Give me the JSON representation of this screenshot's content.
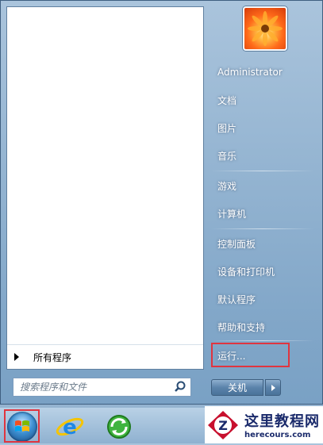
{
  "start_menu": {
    "all_programs": "所有程序",
    "search_placeholder": "搜索程序和文件",
    "user_name": "Administrator",
    "right_items": [
      {
        "label": "文档"
      },
      {
        "label": "图片"
      },
      {
        "label": "音乐"
      },
      {
        "label": "游戏"
      },
      {
        "label": "计算机"
      },
      {
        "label": "控制面板"
      },
      {
        "label": "设备和打印机"
      },
      {
        "label": "默认程序"
      },
      {
        "label": "帮助和支持"
      },
      {
        "label": "运行..."
      }
    ],
    "shutdown_label": "关机"
  },
  "taskbar": {
    "icons": [
      "start-orb-icon",
      "internet-explorer-icon",
      "update-icon"
    ]
  },
  "watermark": {
    "title": "这里教程网",
    "url": "herecours.com"
  },
  "colors": {
    "highlight": "#e0353f",
    "watermark_text": "#1a2a6b"
  }
}
